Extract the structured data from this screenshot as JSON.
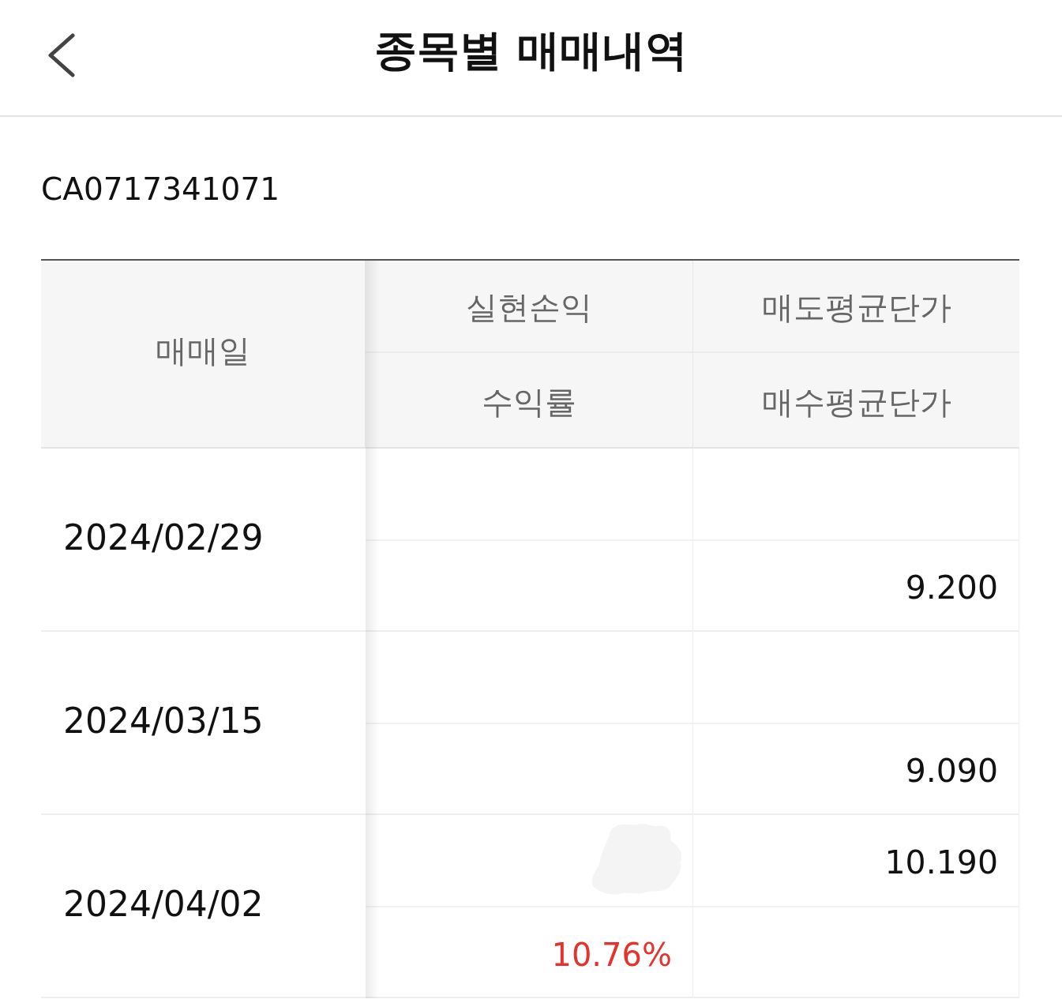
{
  "header": {
    "title": "종목별 매매내역"
  },
  "isin": "CA0717341071",
  "table": {
    "columns": {
      "date": "매매일",
      "realized_pnl": "실현손익",
      "sell_avg_price": "매도평균단가",
      "return_rate": "수익률",
      "buy_avg_price": "매수평균단가"
    },
    "rows": [
      {
        "date": "2024/02/29",
        "pnl_redacted": false,
        "buy_avg_price": "9.200"
      },
      {
        "date": "2024/03/15",
        "pnl_redacted": false,
        "buy_avg_price": "9.090"
      },
      {
        "date": "2024/04/02",
        "pnl_redacted": true,
        "sell_avg_price": "10.190",
        "return_rate": {
          "text": "10.76%",
          "color": "#e5322d"
        }
      }
    ]
  }
}
